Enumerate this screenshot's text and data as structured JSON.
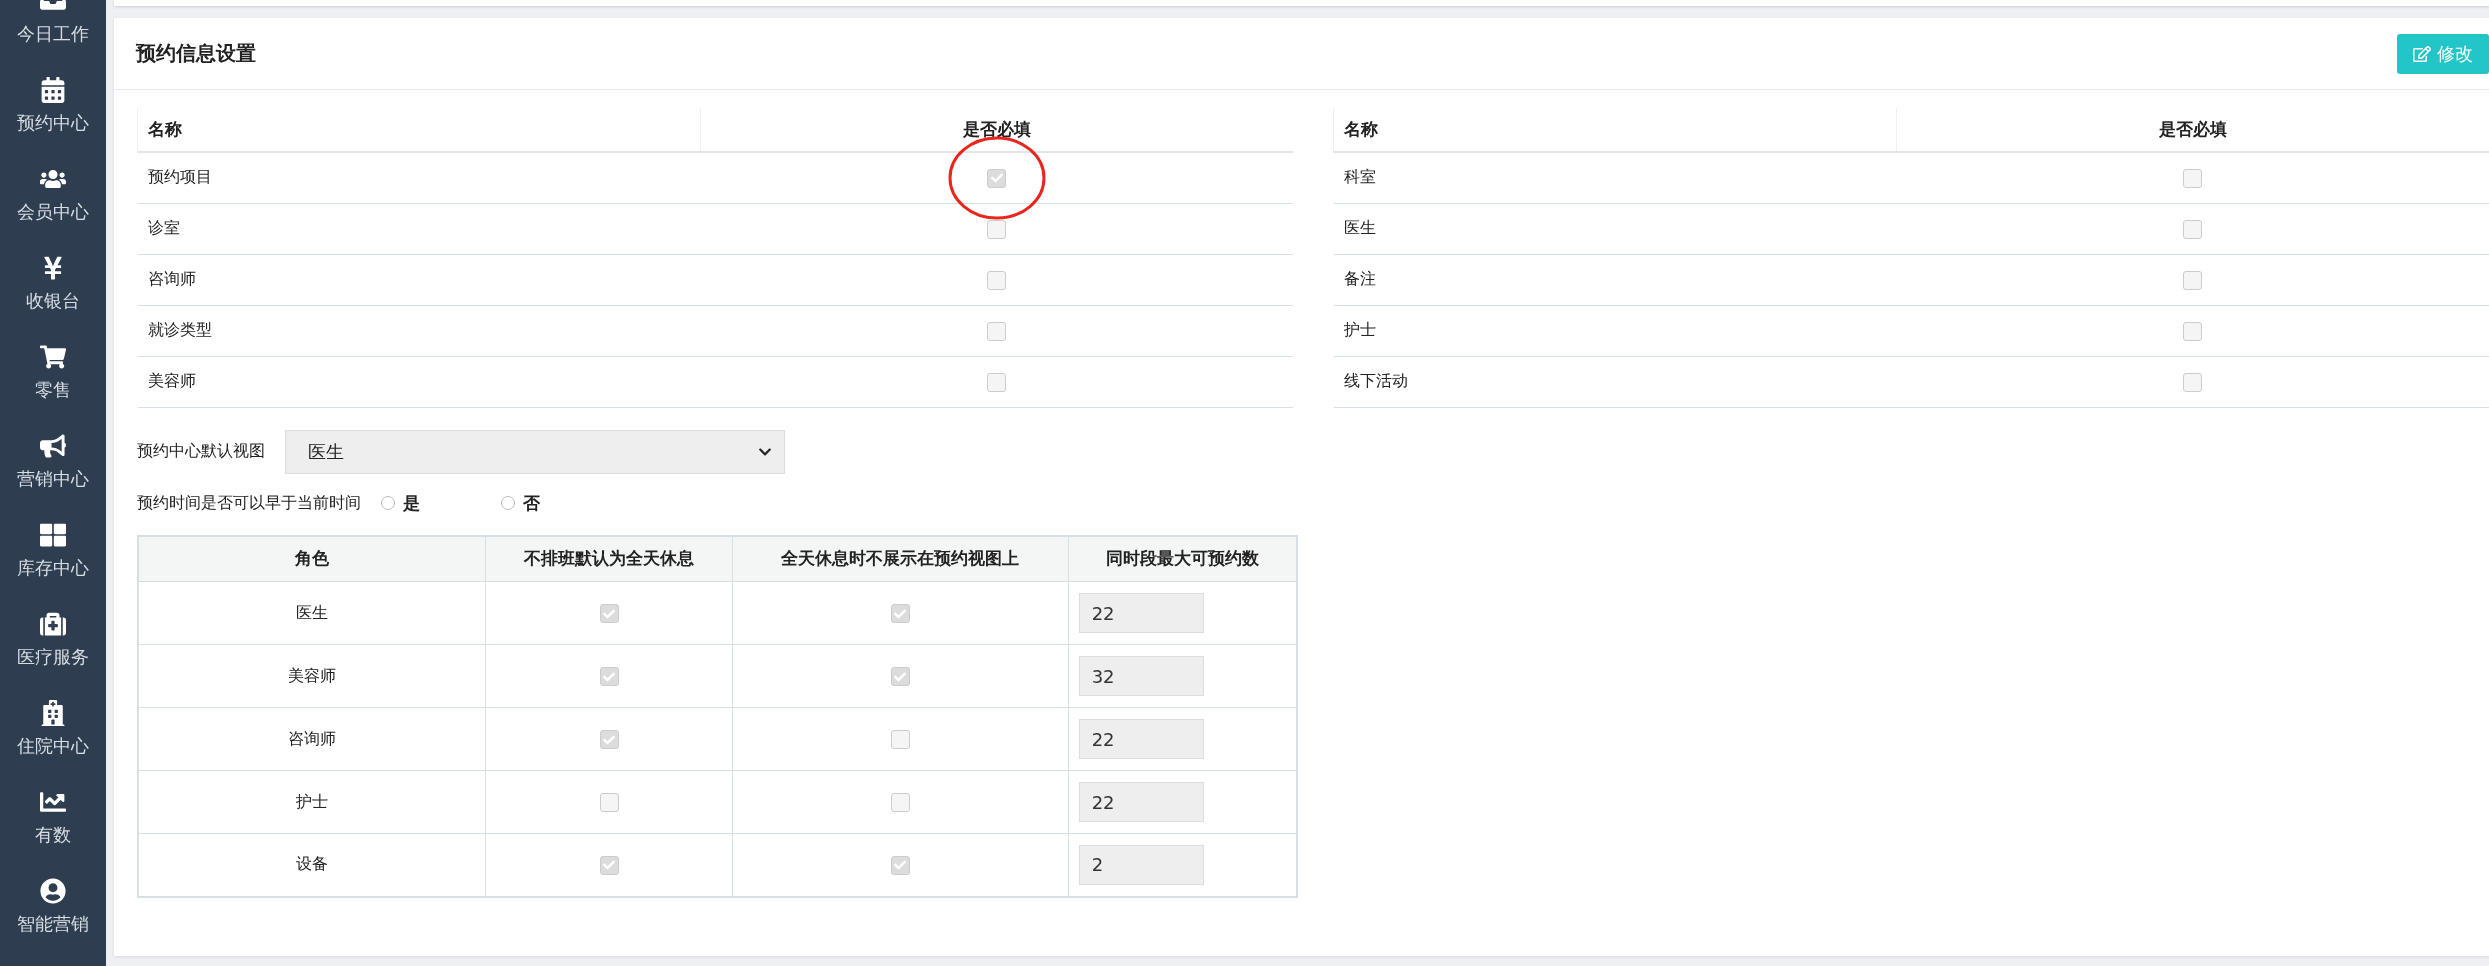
{
  "sidebar": {
    "items": [
      {
        "label": "今日工作"
      },
      {
        "label": "预约中心"
      },
      {
        "label": "会员中心"
      },
      {
        "label": "收银台"
      },
      {
        "label": "零售"
      },
      {
        "label": "营销中心"
      },
      {
        "label": "库存中心"
      },
      {
        "label": "医疗服务"
      },
      {
        "label": "住院中心"
      },
      {
        "label": "有数"
      },
      {
        "label": "智能营销"
      }
    ]
  },
  "card": {
    "title": "预约信息设置",
    "edit_button": "修改"
  },
  "required_tables": [
    {
      "columns": [
        "名称",
        "是否必填"
      ],
      "rows": [
        {
          "name": "预约项目",
          "checked": true,
          "annotated": true
        },
        {
          "name": "诊室",
          "checked": false,
          "annotated": false
        },
        {
          "name": "咨询师",
          "checked": false,
          "annotated": false
        },
        {
          "name": "就诊类型",
          "checked": false,
          "annotated": false
        },
        {
          "name": "美容师",
          "checked": false,
          "annotated": false
        }
      ]
    },
    {
      "columns": [
        "名称",
        "是否必填"
      ],
      "rows": [
        {
          "name": "科室",
          "checked": false,
          "annotated": false
        },
        {
          "name": "医生",
          "checked": false,
          "annotated": false
        },
        {
          "name": "备注",
          "checked": false,
          "annotated": false
        },
        {
          "name": "护士",
          "checked": false,
          "annotated": false
        },
        {
          "name": "线下活动",
          "checked": false,
          "annotated": false
        }
      ]
    }
  ],
  "default_view": {
    "label": "预约中心默认视图",
    "value": "医生"
  },
  "early_time": {
    "label": "预约时间是否可以早于当前时间",
    "options": [
      {
        "label": "是",
        "selected": false
      },
      {
        "label": "否",
        "selected": false
      }
    ]
  },
  "roles_table": {
    "columns": [
      "角色",
      "不排班默认为全天休息",
      "全天休息时不展示在预约视图上",
      "同时段最大可预约数"
    ],
    "rows": [
      {
        "role": "医生",
        "rest_default": true,
        "hide_in_view": true,
        "max": "22"
      },
      {
        "role": "美容师",
        "rest_default": true,
        "hide_in_view": true,
        "max": "32"
      },
      {
        "role": "咨询师",
        "rest_default": true,
        "hide_in_view": false,
        "max": "22"
      },
      {
        "role": "护士",
        "rest_default": false,
        "hide_in_view": false,
        "max": "22"
      },
      {
        "role": "设备",
        "rest_default": true,
        "hide_in_view": true,
        "max": "2"
      }
    ]
  }
}
